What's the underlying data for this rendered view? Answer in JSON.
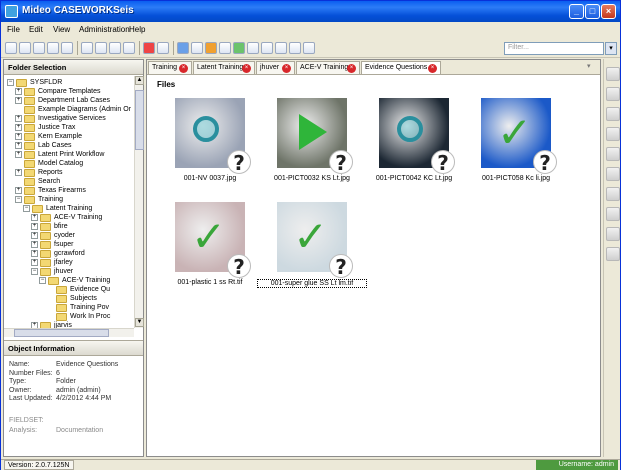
{
  "window": {
    "title": "Mideo CASEWORKSeis"
  },
  "menu": [
    "File",
    "Edit",
    "View",
    "Administration",
    "Help"
  ],
  "toolbar": {
    "filter_placeholder": "Filter..."
  },
  "left_panel": {
    "header": "Folder Selection",
    "tree": [
      {
        "label": "SYSFLDR",
        "level": 0,
        "exp": "minus"
      },
      {
        "label": "Compare Templates",
        "level": 1,
        "exp": "plus"
      },
      {
        "label": "Department Lab Cases",
        "level": 1,
        "exp": "plus"
      },
      {
        "label": "Example Diagrams (Admin Or",
        "level": 1,
        "exp": ""
      },
      {
        "label": "Investigative Services",
        "level": 1,
        "exp": "plus"
      },
      {
        "label": "Justice Trax",
        "level": 1,
        "exp": "plus"
      },
      {
        "label": "Kern Example",
        "level": 1,
        "exp": "plus"
      },
      {
        "label": "Lab Cases",
        "level": 1,
        "exp": "plus"
      },
      {
        "label": "Latent Print Workflow",
        "level": 1,
        "exp": "plus"
      },
      {
        "label": "Model Catalog",
        "level": 1,
        "exp": ""
      },
      {
        "label": "Reports",
        "level": 1,
        "exp": "plus"
      },
      {
        "label": "Search",
        "level": 1,
        "exp": ""
      },
      {
        "label": "Texas Firearms",
        "level": 1,
        "exp": "plus"
      },
      {
        "label": "Training",
        "level": 1,
        "exp": "minus"
      },
      {
        "label": "Latent Training",
        "level": 2,
        "exp": "minus"
      },
      {
        "label": "ACE-V Training",
        "level": 3,
        "exp": "plus"
      },
      {
        "label": "bfire",
        "level": 3,
        "exp": "plus"
      },
      {
        "label": "cyoder",
        "level": 3,
        "exp": "plus"
      },
      {
        "label": "fsuper",
        "level": 3,
        "exp": "plus"
      },
      {
        "label": "gcrawford",
        "level": 3,
        "exp": "plus"
      },
      {
        "label": "jfarley",
        "level": 3,
        "exp": "plus"
      },
      {
        "label": "jhuver",
        "level": 3,
        "exp": "minus"
      },
      {
        "label": "ACE-V Training",
        "level": 4,
        "exp": "minus"
      },
      {
        "label": "Evidence Qu",
        "level": 5,
        "exp": ""
      },
      {
        "label": "Subjects",
        "level": 5,
        "exp": ""
      },
      {
        "label": "Training Pov",
        "level": 5,
        "exp": ""
      },
      {
        "label": "Work In Proc",
        "level": 5,
        "exp": ""
      },
      {
        "label": "jjarvis",
        "level": 3,
        "exp": "plus"
      }
    ]
  },
  "object_info": {
    "header": "Object Information",
    "fields": [
      {
        "key": "Name:",
        "value": "Evidence Questions"
      },
      {
        "key": "Number Files:",
        "value": "6"
      },
      {
        "key": "Type:",
        "value": "Folder"
      },
      {
        "key": "Owner:",
        "value": "admin (admin)"
      },
      {
        "key": "Last Updated:",
        "value": "4/2/2012 4:44 PM"
      }
    ],
    "fieldset_label": "FIELDSET:",
    "analysis_key": "Analysis:",
    "analysis_value": "Documentation"
  },
  "tabs": [
    {
      "label": "Training"
    },
    {
      "label": "Latent Training"
    },
    {
      "label": "jhuver"
    },
    {
      "label": "ACE-V Training"
    },
    {
      "label": "Evidence Questions"
    }
  ],
  "files": {
    "header": "Files",
    "items": [
      {
        "name": "001-NV 0037.jpg",
        "icon": "magnifier-icon",
        "bg": "#9aa3b5"
      },
      {
        "name": "001-PICT0032 KS Lt.jpg",
        "icon": "play-triangle-icon",
        "bg": "#6e7468"
      },
      {
        "name": "001-PICT0042 KC Lt.jpg",
        "icon": "magnifier-icon",
        "bg": "#1c2733"
      },
      {
        "name": "001-PICT058 Kc li.jpg",
        "icon": "checkmark-icon",
        "bg": "#1b59c8"
      },
      {
        "name": "001-plastic 1 ss Rt.tif",
        "icon": "checkmark-icon",
        "bg": "#c9b3b5"
      },
      {
        "name": "001-super glue SS Lt lm.tif",
        "icon": "checkmark-icon",
        "bg": "#cdd9e0"
      }
    ]
  },
  "status": {
    "version": "Version: 2.0.7.125N",
    "user": "Username: admin"
  },
  "colors": {
    "titlebar": "#0a5ef0",
    "user_badge": "#4e9a3f",
    "close_tab": "#d8272b"
  }
}
